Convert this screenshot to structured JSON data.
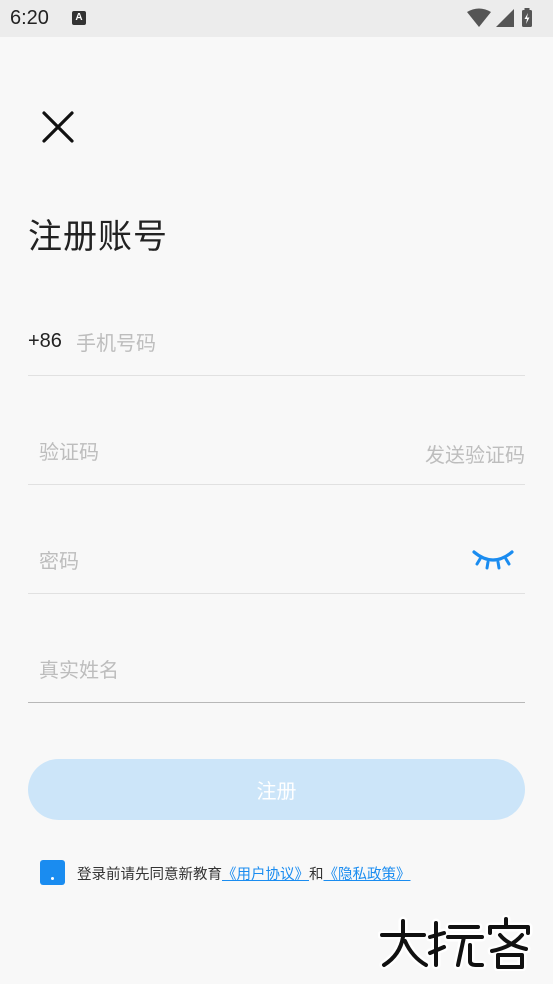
{
  "status_bar": {
    "time": "6:20",
    "notification_icon": "A"
  },
  "header": {
    "close_icon": "close-icon",
    "title": "注册账号"
  },
  "form": {
    "country_code": "+86",
    "phone_placeholder": "手机号码",
    "code_placeholder": "验证码",
    "send_code_label": "发送验证码",
    "password_placeholder": "密码",
    "password_toggle_icon": "eye-closed-icon",
    "name_placeholder": "真实姓名",
    "submit_label": "注册"
  },
  "agreement": {
    "prefix": "登录前请先同意新教育",
    "user_agreement": "《用户协议》",
    "conjunction": "和",
    "privacy_policy": "《隐私政策》"
  },
  "watermark": "大玩客",
  "colors": {
    "accent": "#1a8cf0",
    "button_disabled": "#cce5f9",
    "placeholder": "#bdbdbd",
    "background": "#f8f8f8"
  }
}
